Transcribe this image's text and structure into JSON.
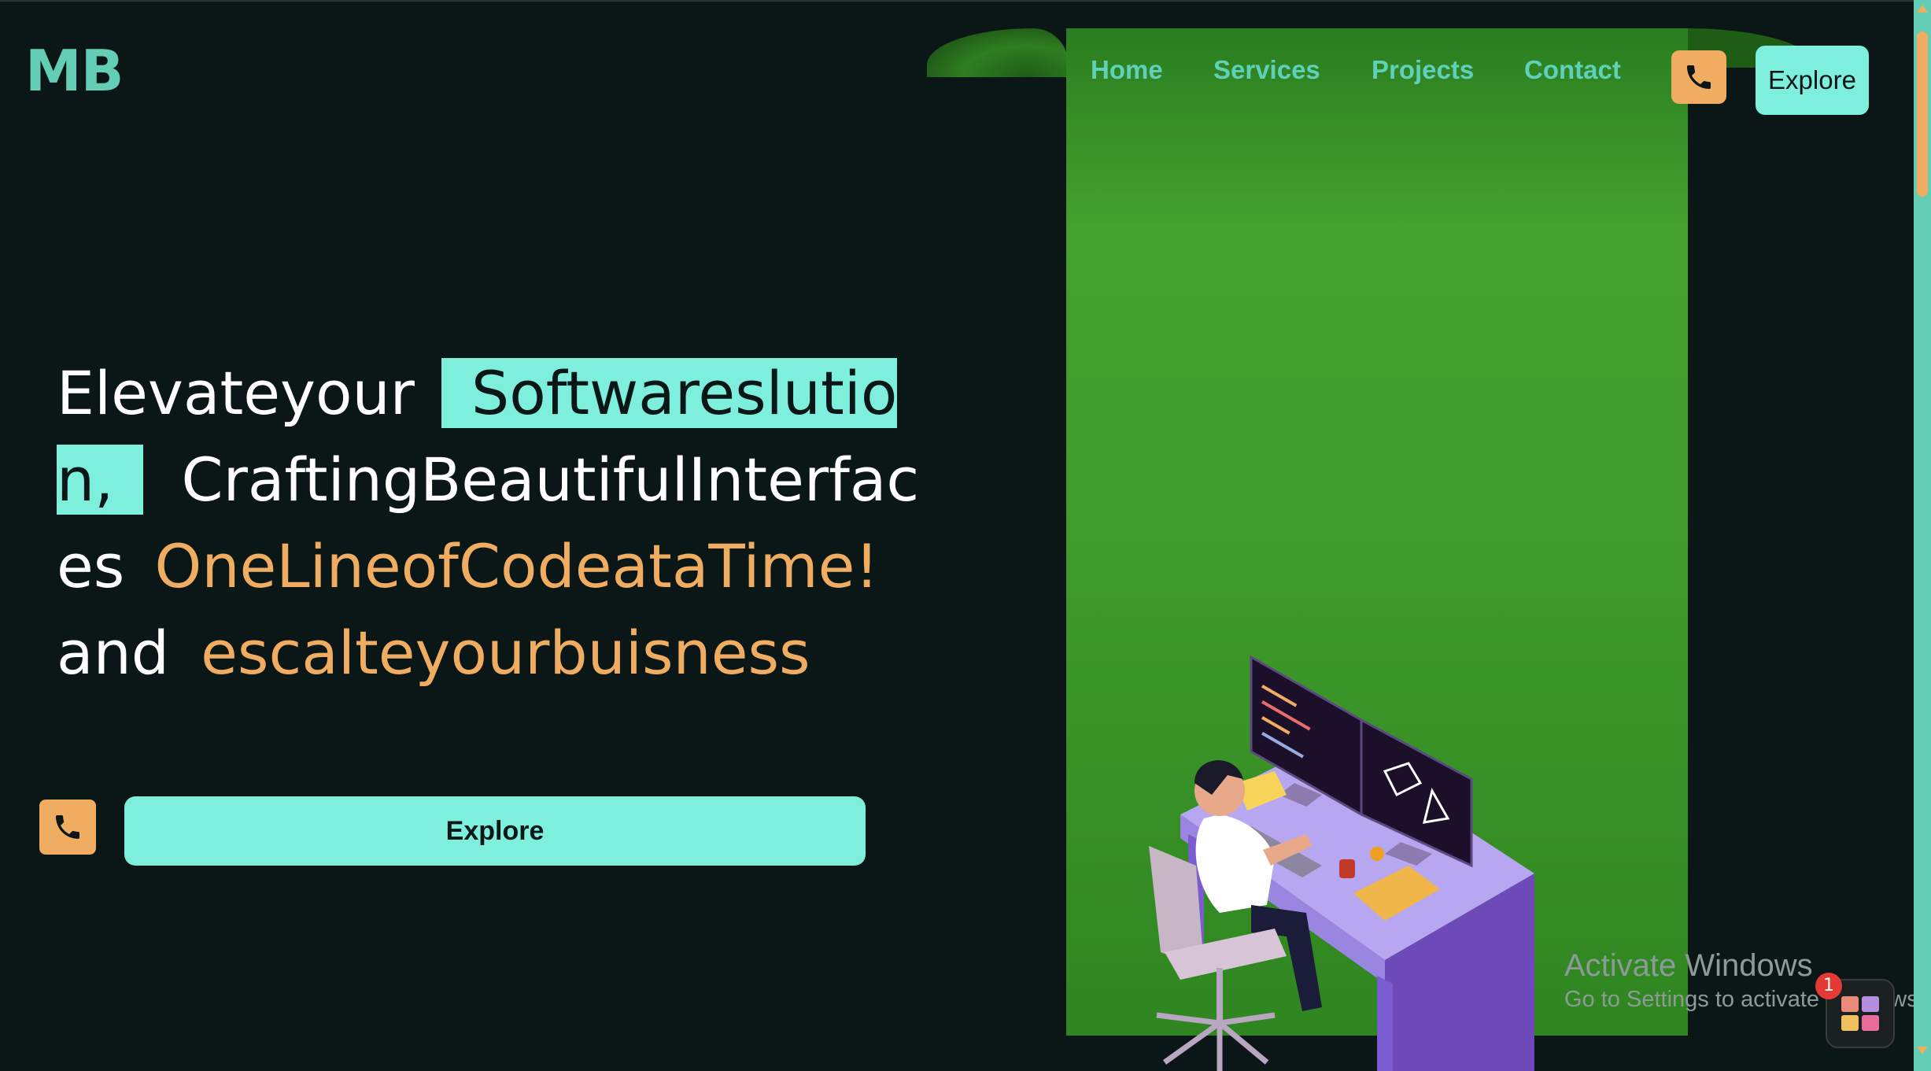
{
  "brand": {
    "logo": "MB"
  },
  "nav": {
    "items": [
      {
        "label": "Home"
      },
      {
        "label": "Services"
      },
      {
        "label": "Projects"
      },
      {
        "label": "Contact"
      }
    ],
    "call_icon": "phone-icon",
    "explore_label": "Explore"
  },
  "hero": {
    "line1_text": "Elevateyour ",
    "line1_highlight": "Softwareslutio",
    "line2_highlight": "n,",
    "line2_text": "CraftingBeautifulInterfac",
    "line3_text": "es ",
    "line3_orange": "OneLineofCodeataTime!",
    "line4_text": "and ",
    "line4_orange": "escalteyourbuisness"
  },
  "cta": {
    "call_icon": "phone-icon",
    "explore_label": "Explore"
  },
  "watermark": {
    "title": "Activate Windows",
    "subtitle": "Go to Settings to activate Windows."
  },
  "tray": {
    "badge": "1"
  },
  "colors": {
    "background": "#0b1716",
    "accent_teal": "#7eeedd",
    "accent_orange": "#f0ad62",
    "banner_green": "#45a22e",
    "logo": "#63cdb6"
  }
}
